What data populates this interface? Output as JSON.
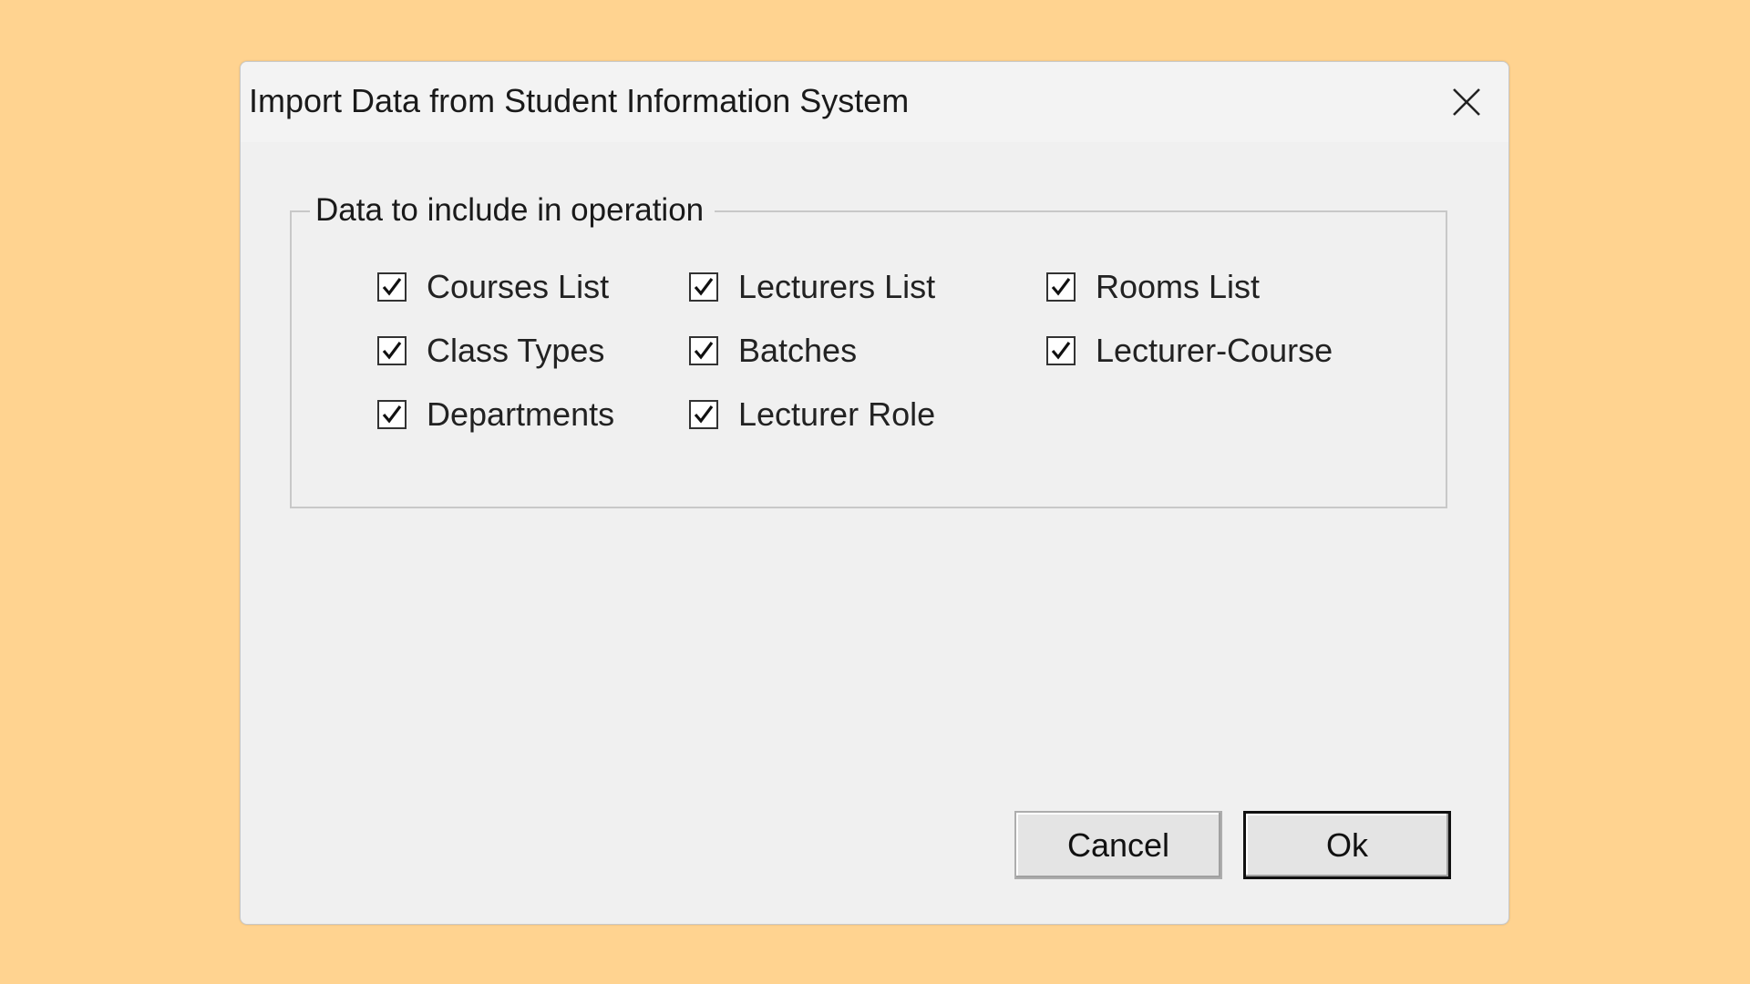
{
  "window": {
    "title": "Import Data from Student Information System",
    "close_icon": "close-icon"
  },
  "group": {
    "label": "Data to include in operation",
    "checkboxes": [
      {
        "label": "Courses List",
        "checked": true
      },
      {
        "label": "Class Types",
        "checked": true
      },
      {
        "label": "Departments",
        "checked": true
      },
      {
        "label": "Lecturers List",
        "checked": true
      },
      {
        "label": "Batches",
        "checked": true
      },
      {
        "label": "Lecturer Role",
        "checked": true
      },
      {
        "label": "Rooms List",
        "checked": true
      },
      {
        "label": "Lecturer-Course",
        "checked": true
      }
    ]
  },
  "buttons": {
    "cancel_label": "Cancel",
    "ok_label": "Ok"
  },
  "colors": {
    "background": "#FFD390",
    "dialog": "#F0F0F0"
  }
}
